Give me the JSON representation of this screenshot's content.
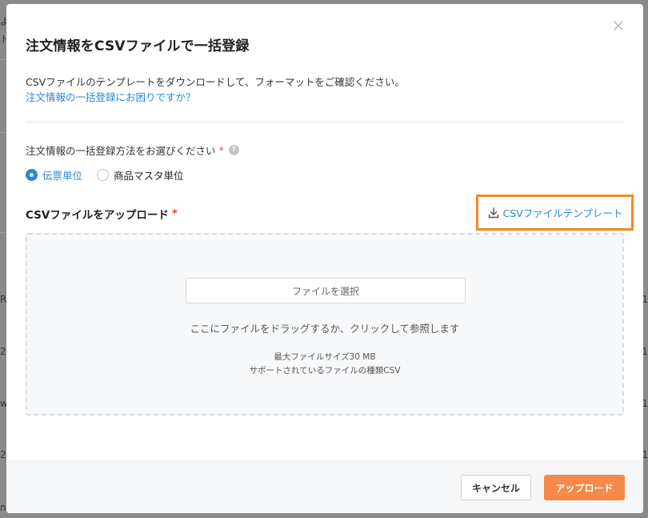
{
  "background": {
    "left_fragments": [
      "よ",
      "ト",
      "R",
      "2",
      "w",
      "2",
      "n"
    ],
    "right_fragments": [
      "1",
      "1",
      "1",
      "1"
    ]
  },
  "modal": {
    "title": "注文情報をCSVファイルで一括登録",
    "description": "CSVファイルのテンプレートをダウンロードして、フォーマットをご確認ください。",
    "help_link": "注文情報の一括登録にお困りですか？",
    "method": {
      "label": "注文情報の一括登録方法をお選びください",
      "required_mark": "*",
      "help_icon": "?",
      "options": [
        {
          "label": "伝票単位",
          "checked": true
        },
        {
          "label": "商品マスタ単位",
          "checked": false
        }
      ]
    },
    "upload": {
      "label": "CSVファイルをアップロード",
      "required_mark": "*",
      "template_button": "CSVファイルテンプレート",
      "file_button": "ファイルを選択",
      "drop_hint": "ここにファイルをドラッグするか、クリックして参照します",
      "max_size": "最大ファイルサイズ30 MB",
      "file_types": "サポートされているファイルの種類CSV"
    },
    "footer": {
      "cancel": "キャンセル",
      "upload": "アップロード"
    }
  },
  "colors": {
    "accent": "#2b86d4",
    "highlight": "#f08a23",
    "primary_button": "#f4894a",
    "required": "#e5473c"
  }
}
